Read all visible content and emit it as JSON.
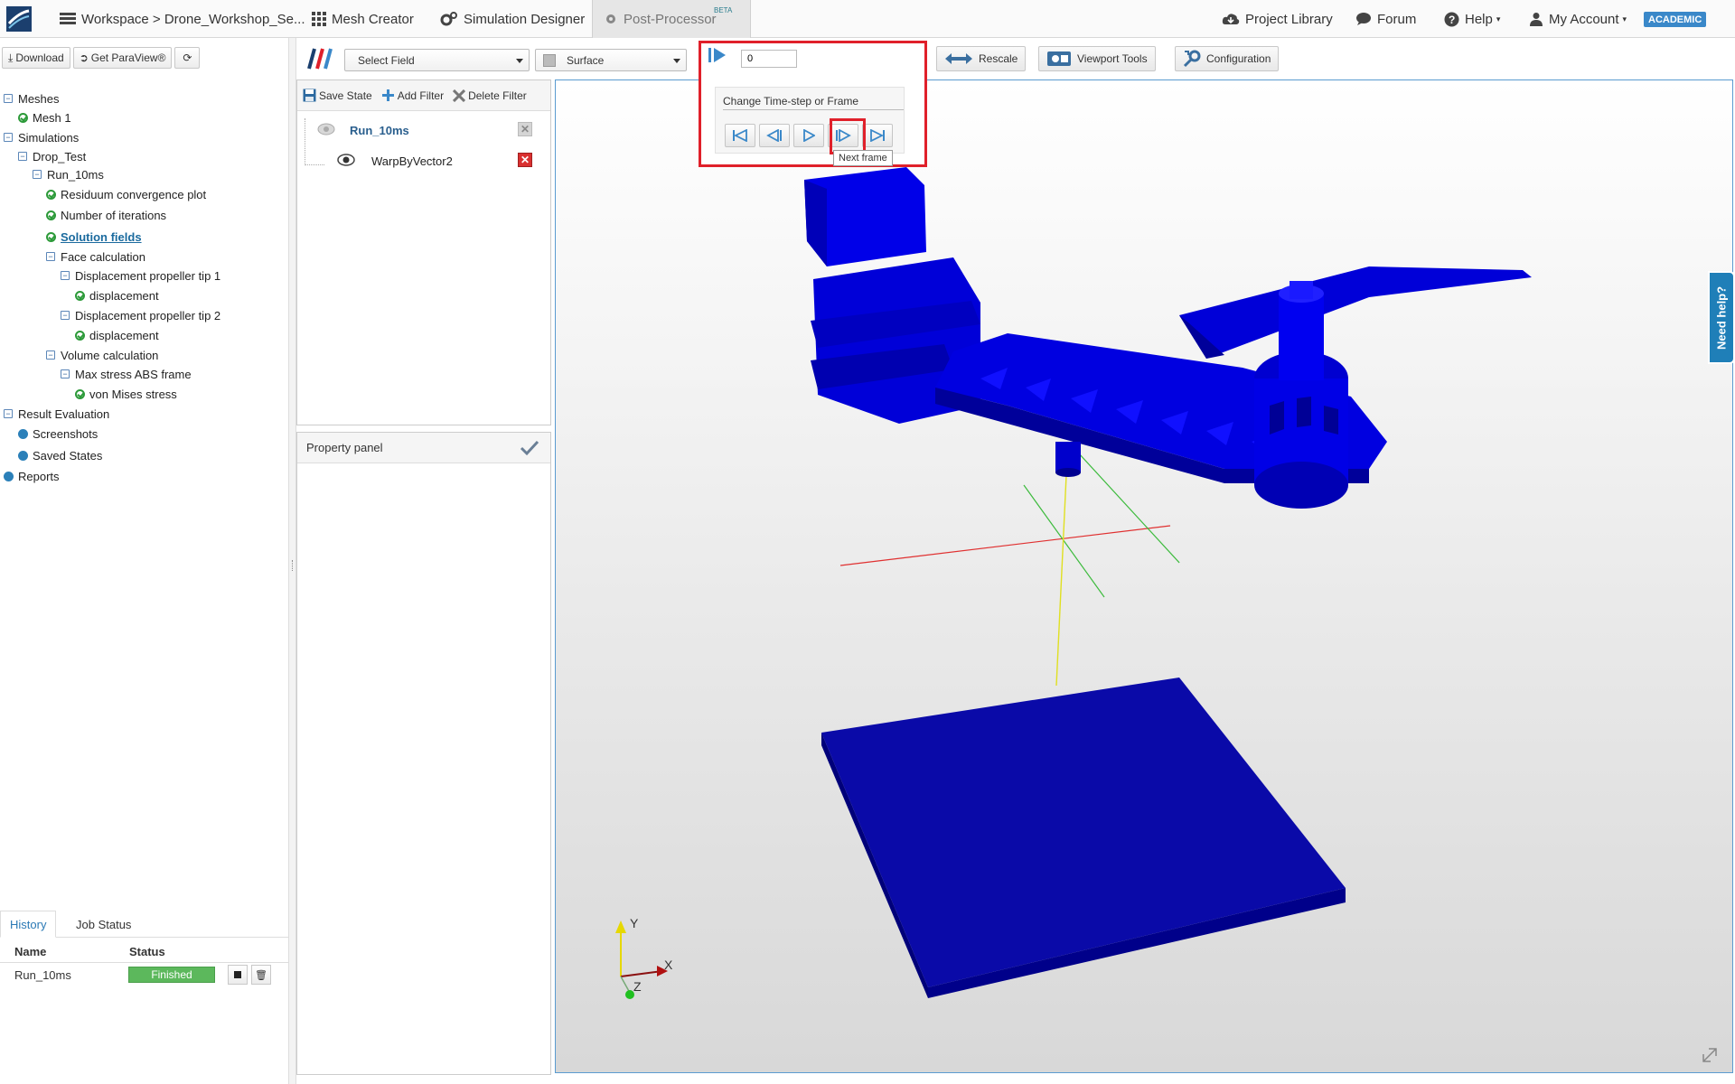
{
  "nav": {
    "workspace": "Workspace > Drone_Workshop_Se...",
    "mesh_creator": "Mesh Creator",
    "simulation_designer": "Simulation Designer",
    "post_processor": "Post-Processor",
    "beta": "BETA",
    "project_library": "Project Library",
    "forum": "Forum",
    "help": "Help",
    "my_account": "My Account",
    "academic": "ACADEMIC"
  },
  "left_toolbar": {
    "download": "Download",
    "get_paraview": "Get ParaView®"
  },
  "tree": {
    "meshes": "Meshes",
    "mesh1": "Mesh 1",
    "simulations": "Simulations",
    "drop_test": "Drop_Test",
    "run_10ms": "Run_10ms",
    "residuum": "Residuum convergence plot",
    "iterations": "Number of iterations",
    "solution_fields": "Solution fields",
    "face_calc": "Face calculation",
    "disp_tip1": "Displacement propeller tip 1",
    "displacement1": "displacement",
    "disp_tip2": "Displacement propeller tip 2",
    "displacement2": "displacement",
    "volume_calc": "Volume calculation",
    "max_stress": "Max stress ABS frame",
    "von_mises": "von Mises stress",
    "result_eval": "Result Evaluation",
    "screenshots": "Screenshots",
    "saved_states": "Saved States",
    "reports": "Reports"
  },
  "bottom": {
    "tab_history": "History",
    "tab_job_status": "Job Status",
    "col_name": "Name",
    "col_status": "Status",
    "job_name": "Run_10ms",
    "job_status": "Finished"
  },
  "toolbar": {
    "select_field": "Select Field",
    "representation": "Surface",
    "frame_value": "0",
    "rescale": "Rescale",
    "viewport_tools": "Viewport Tools",
    "configuration": "Configuration"
  },
  "pipeline": {
    "save_state": "Save State",
    "add_filter": "Add Filter",
    "delete_filter": "Delete Filter",
    "item1": "Run_10ms",
    "item2": "WarpByVector2"
  },
  "property_panel": {
    "title": "Property panel"
  },
  "timestep": {
    "label": "Change Time-step or Frame",
    "tooltip": "Next frame"
  },
  "need_help": "Need help?",
  "axes": {
    "y": "Y",
    "x": "X",
    "z": "Z"
  },
  "colors": {
    "model_blue": "#0a0ad8",
    "highlight_red": "#e0202a",
    "link_blue": "#1a6a9e",
    "finished_green": "#5cb85c"
  }
}
